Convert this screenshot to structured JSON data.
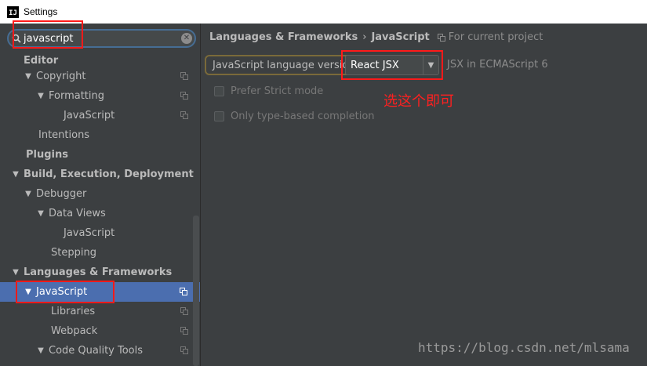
{
  "window": {
    "title": "Settings",
    "app_icon": "IJ"
  },
  "search": {
    "value": "javascript"
  },
  "sidebar": {
    "items": [
      {
        "label": "Editor",
        "arrow": ""
      },
      {
        "label": "Copyright",
        "arrow": "▼"
      },
      {
        "label": "Formatting",
        "arrow": "▼"
      },
      {
        "label": "JavaScript",
        "arrow": ""
      },
      {
        "label": "Intentions",
        "arrow": ""
      },
      {
        "label": "Plugins",
        "arrow": ""
      },
      {
        "label": "Build, Execution, Deployment",
        "arrow": "▼"
      },
      {
        "label": "Debugger",
        "arrow": "▼"
      },
      {
        "label": "Data Views",
        "arrow": "▼"
      },
      {
        "label": "JavaScript",
        "arrow": ""
      },
      {
        "label": "Stepping",
        "arrow": ""
      },
      {
        "label": "Languages & Frameworks",
        "arrow": "▼"
      },
      {
        "label": "JavaScript",
        "arrow": "▼"
      },
      {
        "label": "Libraries",
        "arrow": ""
      },
      {
        "label": "Webpack",
        "arrow": ""
      },
      {
        "label": "Code Quality Tools",
        "arrow": "▼"
      }
    ],
    "selected_color": "#4b6eaf"
  },
  "breadcrumb": {
    "section": "Languages & Frameworks",
    "separator": "›",
    "page": "JavaScript",
    "scope_note": "For current project"
  },
  "language_version": {
    "label": "JavaScript language version",
    "selected": "React JSX",
    "note": "JSX in ECMAScript 6"
  },
  "options": {
    "strict_mode": "Prefer Strict mode",
    "type_based": "Only type-based completion"
  },
  "annotation": {
    "text": "选这个即可",
    "color": "#ff2020"
  },
  "watermark": "https://blog.csdn.net/mlsama"
}
